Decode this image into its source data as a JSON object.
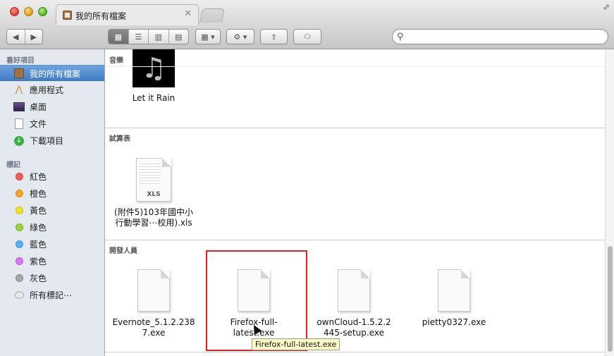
{
  "window": {
    "tab_title": "我的所有檔案",
    "tab_close": "✕"
  },
  "toolbar": {
    "back_glyph": "◀",
    "forward_glyph": "▶",
    "view_icons": "▦",
    "view_list": "☰",
    "view_columns": "▥",
    "view_coverflow": "▤",
    "arrange_glyph": "▦ ▾",
    "action_glyph": "⚙ ▾",
    "share_glyph": "⇪",
    "tag_glyph": "⬭",
    "search_placeholder": ""
  },
  "sidebar": {
    "favorites_header": "喜好項目",
    "favorites": [
      {
        "label": "我的所有檔案",
        "icon": "all-files-icon"
      },
      {
        "label": "應用程式",
        "icon": "applications-icon"
      },
      {
        "label": "桌面",
        "icon": "desktop-icon"
      },
      {
        "label": "文件",
        "icon": "documents-icon"
      },
      {
        "label": "下載項目",
        "icon": "downloads-icon"
      }
    ],
    "tags_header": "標記",
    "tags": [
      {
        "label": "紅色",
        "color": "#f25c5c"
      },
      {
        "label": "橙色",
        "color": "#f5a623"
      },
      {
        "label": "黃色",
        "color": "#f1e02a"
      },
      {
        "label": "綠色",
        "color": "#9ad43a"
      },
      {
        "label": "藍色",
        "color": "#58b1f5"
      },
      {
        "label": "紫色",
        "color": "#d67cf0"
      },
      {
        "label": "灰色",
        "color": "#a9a9a9"
      },
      {
        "label": "所有標記⋯",
        "color": "#d7d7d7"
      }
    ]
  },
  "content": {
    "sections": [
      {
        "label": "音樂",
        "files": [
          {
            "name": "Let it Rain",
            "icon": "music-album-icon"
          }
        ]
      },
      {
        "label": "試算表",
        "files": [
          {
            "name_line1": "(附件5)103年國中小",
            "name_line2": "行動學習⋯校用).xls",
            "icon": "xls-file-icon",
            "icon_tag": "XLS"
          }
        ]
      },
      {
        "label": "開發人員",
        "files": [
          {
            "name_line1": "Evernote_5.1.2.238",
            "name_line2": "7.exe"
          },
          {
            "name_line1": "Firefox-full-",
            "name_line2": "latest.exe"
          },
          {
            "name_line1": "ownCloud-1.5.2.2",
            "name_line2": "445-setup.exe"
          },
          {
            "name_line1": "pietty0327.exe",
            "name_line2": ""
          }
        ]
      }
    ],
    "tooltip": "Firefox-full-latest.exe"
  }
}
